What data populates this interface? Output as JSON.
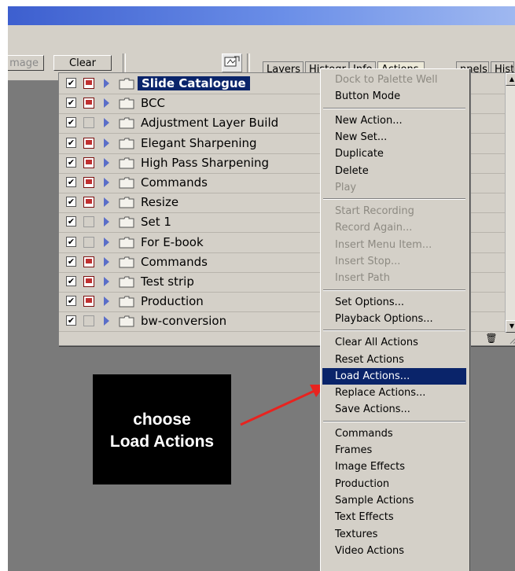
{
  "toolbar": {
    "image_button": "mage",
    "clear_button": "Clear",
    "tabs": [
      "Layers",
      "History",
      "Info",
      "Actions",
      "Channels",
      "Hist"
    ],
    "tab_fragments": [
      "Layers",
      "Histogr",
      "Info",
      "Actions",
      "nnels",
      "Hist"
    ]
  },
  "actions_list": {
    "rows": [
      {
        "label": "Slide Catalogue",
        "checked": true,
        "dialog": true,
        "selected": true
      },
      {
        "label": "BCC",
        "checked": true,
        "dialog": true
      },
      {
        "label": "Adjustment Layer Build",
        "checked": true,
        "dialog": false
      },
      {
        "label": "Elegant Sharpening",
        "checked": true,
        "dialog": true
      },
      {
        "label": "High Pass Sharpening",
        "checked": true,
        "dialog": true
      },
      {
        "label": "Commands",
        "checked": true,
        "dialog": true
      },
      {
        "label": "Resize",
        "checked": true,
        "dialog": true
      },
      {
        "label": "Set 1",
        "checked": true,
        "dialog": false
      },
      {
        "label": "For E-book",
        "checked": true,
        "dialog": false
      },
      {
        "label": "Commands",
        "checked": true,
        "dialog": true
      },
      {
        "label": "Test strip",
        "checked": true,
        "dialog": true
      },
      {
        "label": "Production",
        "checked": true,
        "dialog": true
      },
      {
        "label": "bw-conversion",
        "checked": true,
        "dialog": false
      }
    ]
  },
  "menu": {
    "groups": [
      [
        {
          "label": "Dock to Palette Well",
          "disabled": true
        },
        {
          "label": "Button Mode"
        }
      ],
      [
        {
          "label": "New Action..."
        },
        {
          "label": "New Set..."
        },
        {
          "label": "Duplicate"
        },
        {
          "label": "Delete"
        },
        {
          "label": "Play",
          "disabled": true
        }
      ],
      [
        {
          "label": "Start Recording",
          "disabled": true
        },
        {
          "label": "Record Again...",
          "disabled": true
        },
        {
          "label": "Insert Menu Item...",
          "disabled": true
        },
        {
          "label": "Insert Stop...",
          "disabled": true
        },
        {
          "label": "Insert Path",
          "disabled": true
        }
      ],
      [
        {
          "label": "Set Options..."
        },
        {
          "label": "Playback Options..."
        }
      ],
      [
        {
          "label": "Clear All Actions"
        },
        {
          "label": "Reset Actions"
        },
        {
          "label": "Load Actions...",
          "highlighted": true
        },
        {
          "label": "Replace Actions..."
        },
        {
          "label": "Save Actions..."
        }
      ],
      [
        {
          "label": "Commands"
        },
        {
          "label": "Frames"
        },
        {
          "label": "Image Effects"
        },
        {
          "label": "Production"
        },
        {
          "label": "Sample Actions"
        },
        {
          "label": "Text Effects"
        },
        {
          "label": "Textures"
        },
        {
          "label": "Video Actions"
        }
      ]
    ]
  },
  "callout": {
    "line1": "choose",
    "line2": "Load Actions"
  },
  "colors": {
    "highlight": "#0a246a",
    "arrow": "#e8231f",
    "dialog_red": "#c03030"
  },
  "icons": {
    "row_toggle": "checkmark-icon",
    "row_dialog": "dialog-toggle-icon",
    "row_expand": "expand-triangle-icon",
    "row_folder": "folder-icon",
    "palette_well": "palette-well-icon",
    "trash": "trash-icon"
  }
}
